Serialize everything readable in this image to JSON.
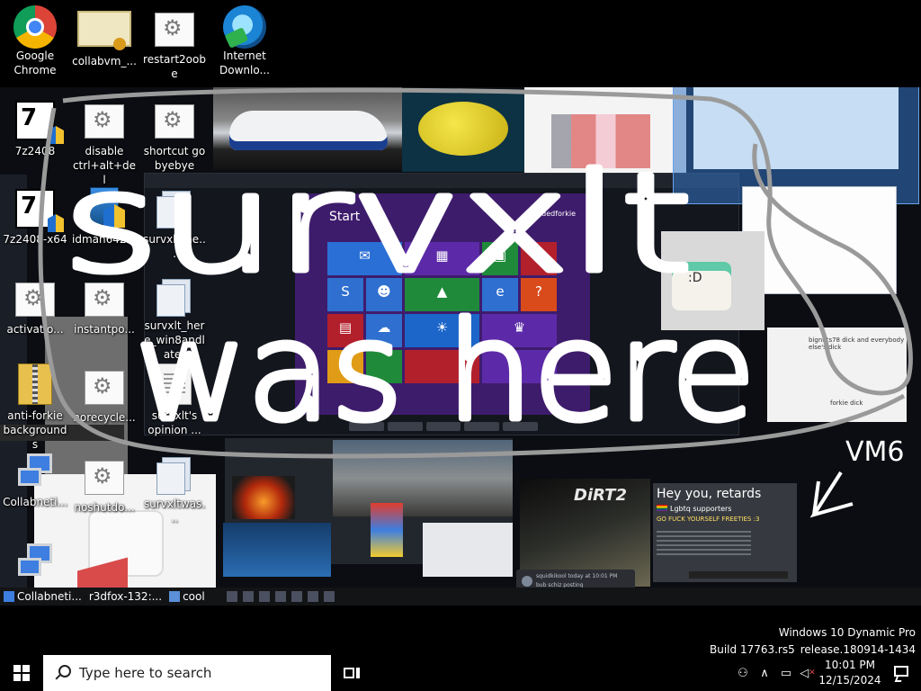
{
  "desktop": {
    "icons": [
      {
        "id": "chrome",
        "label": "Google Chrome",
        "icon": "chrome-icon"
      },
      {
        "id": "collabvm",
        "label": "collabvm_...",
        "icon": "certificate-icon"
      },
      {
        "id": "restart2oobe",
        "label": "restart2oobe",
        "icon": "settings-file-icon"
      },
      {
        "id": "idm",
        "label": "Internet Downlo...",
        "icon": "internet-download-manager-icon"
      },
      {
        "id": "7z2408",
        "label": "7z2408",
        "icon": "7zip-installer-icon"
      },
      {
        "id": "disable",
        "label": "disable ctrl+alt+del",
        "icon": "settings-file-icon"
      },
      {
        "id": "shortcut",
        "label": "shortcut go byebye",
        "icon": "settings-file-icon"
      },
      {
        "id": "7z2408x64",
        "label": "7z2408-x64",
        "icon": "7zip-installer-icon"
      },
      {
        "id": "idman",
        "label": "idman642...",
        "icon": "idm-installer-icon"
      },
      {
        "id": "survxlt_he",
        "label": "survxlt_he...",
        "icon": "stacked-files-icon"
      },
      {
        "id": "activation",
        "label": "activatio...",
        "icon": "settings-file-icon"
      },
      {
        "id": "instantpo",
        "label": "instantpo...",
        "icon": "settings-file-icon"
      },
      {
        "id": "survxlt_here_win8",
        "label": "survxlt_here_win8andlater",
        "icon": "stacked-files-icon"
      },
      {
        "id": "antiforkie",
        "label": "anti-forkie backgrounds",
        "icon": "zip-folder-icon"
      },
      {
        "id": "norecycle",
        "label": "norecycle...",
        "icon": "settings-file-icon"
      },
      {
        "id": "opinion",
        "label": "survxlt's opinion ...",
        "icon": "text-document-icon"
      },
      {
        "id": "collabnet1",
        "label": "Collabneti...",
        "icon": "network-computers-icon"
      },
      {
        "id": "noshutdo",
        "label": "noshutdo...",
        "icon": "settings-file-icon"
      },
      {
        "id": "survxltwas",
        "label": "survxltwas...",
        "icon": "stacked-files-icon"
      },
      {
        "id": "collabnet2",
        "label": "Collabneti...",
        "icon": "network-computers-icon"
      }
    ]
  },
  "graffiti": {
    "line1": "survxlt",
    "line2": "was here",
    "tag": "VM6"
  },
  "collage": {
    "start_screen_title": "Start",
    "start_screen_user": "retardedforkie",
    "comic_note": "bignuts78 dick and everybody else's dick",
    "comic_note2": "forkie dick",
    "dirt_logo": "DiRT2",
    "comment_user": "squidkikool today at 10:01 PM",
    "comment_text": "bub schiz posting",
    "banner_title": "Hey you, retards",
    "banner_sub": "Lgbtq supporters",
    "banner_line": "GO FUCK YOURSELF FREETIES :3"
  },
  "inner_taskbar": {
    "items": [
      {
        "label": "Collabneti..."
      },
      {
        "label": "r3dfox-132:..."
      },
      {
        "label": "cool"
      }
    ]
  },
  "watermark": {
    "line1": "Windows 10 Dynamic Pro",
    "line2": "Build 17763.rs5_release.180914-1434"
  },
  "taskbar": {
    "search_placeholder": "Type here to search",
    "time": "10:01 PM",
    "date": "12/15/2024"
  }
}
